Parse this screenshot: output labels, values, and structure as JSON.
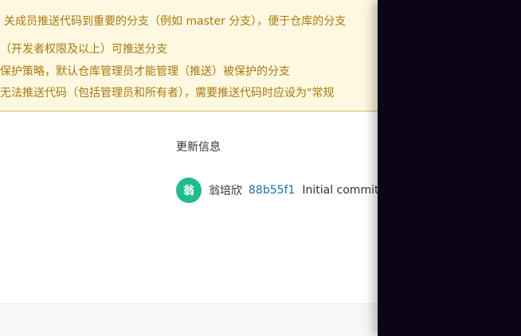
{
  "notice": {
    "line1": "关成员推送代码到重要的分支（例如 master 分支），便于仓库的分支",
    "line2": "（开发者权限及以上）可推送分支",
    "line3": "保护策略，默认仓库管理员才能管理（推送）被保护的分支",
    "line4": "无法推送代码（包括管理员和所有者），需要推送代码时应设为\"常规"
  },
  "update_info": {
    "title": "更新信息",
    "commit": {
      "avatar_text": "翁",
      "author": "翁培欣",
      "sha": "88b55f1",
      "message": "Initial commit"
    }
  },
  "colors": {
    "notice_bg": "#fff8e1",
    "notice_text": "#a8790e",
    "avatar_bg": "#1fbc8f",
    "sha_link": "#1b6fa6",
    "overlay": "#0c0418"
  }
}
